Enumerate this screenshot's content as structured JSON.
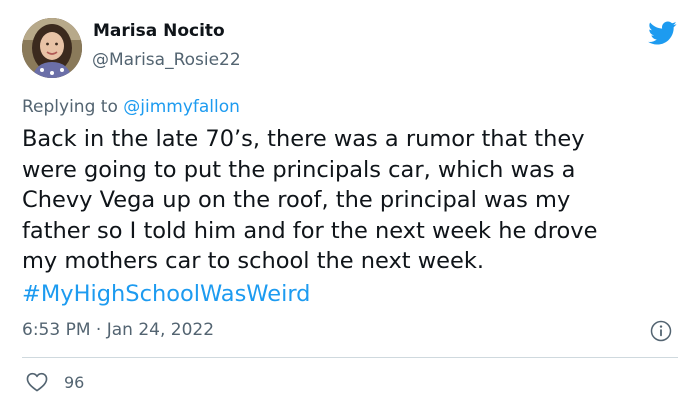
{
  "author": {
    "name": "Marisa Nocito",
    "handle": "@Marisa_Rosie22",
    "avatar_icon": "profile-photo"
  },
  "brand": {
    "icon": "twitter-bird-icon",
    "color": "#1d9bf0"
  },
  "reply": {
    "prefix": "Replying to",
    "mention": "@jimmyfallon"
  },
  "tweet": {
    "lines": [
      "Back in the late 70’s, there was a rumor that they",
      "were going to put the principals car, which was a",
      "Chevy Vega up on the roof, the principal was my",
      "father so I told him and for the next week he drove",
      "my mothers car to school the next week."
    ],
    "hashtag": "#MyHighSchoolWasWeird"
  },
  "meta": {
    "timestamp": "6:53 PM · Jan 24, 2022",
    "info_icon": "info-icon"
  },
  "engagement": {
    "likes": "96",
    "like_icon": "heart-icon"
  },
  "colors": {
    "text": "#0f1419",
    "secondary": "#536471",
    "link": "#1d9bf0",
    "divider": "#cfd9de"
  }
}
